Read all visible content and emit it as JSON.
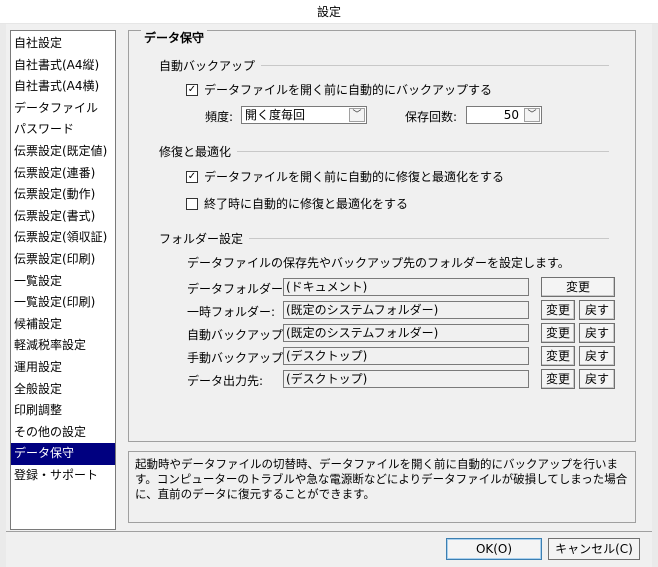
{
  "window": {
    "title": "設定"
  },
  "sidebar": {
    "items": [
      "自社設定",
      "自社書式(A4縦)",
      "自社書式(A4横)",
      "データファイル",
      "パスワード",
      "伝票設定(既定値)",
      "伝票設定(連番)",
      "伝票設定(動作)",
      "伝票設定(書式)",
      "伝票設定(領収証)",
      "伝票設定(印刷)",
      "一覧設定",
      "一覧設定(印刷)",
      "候補設定",
      "軽減税率設定",
      "運用設定",
      "全般設定",
      "印刷調整",
      "その他の設定",
      "データ保守",
      "登録・サポート"
    ],
    "selected_index": 19
  },
  "main": {
    "title": "データ保守",
    "auto_backup": {
      "section_label": "自動バックアップ",
      "checkbox_label": "データファイルを開く前に自動的にバックアップする",
      "checked": true,
      "frequency_label": "頻度:",
      "frequency_value": "開く度毎回",
      "count_label": "保存回数:",
      "count_value": "50"
    },
    "repair": {
      "section_label": "修復と最適化",
      "open_label": "データファイルを開く前に自動的に修復と最適化をする",
      "open_checked": true,
      "exit_label": "終了時に自動的に修復と最適化をする",
      "exit_checked": false
    },
    "folders": {
      "section_label": "フォルダー設定",
      "description": "データファイルの保存先やバックアップ先のフォルダーを設定します。",
      "rows": [
        {
          "label": "データフォルダー:",
          "value": "(ドキュメント)"
        },
        {
          "label": "一時フォルダー:",
          "value": "(既定のシステムフォルダー)"
        },
        {
          "label": "自動バックアップ:",
          "value": "(既定のシステムフォルダー)"
        },
        {
          "label": "手動バックアップ:",
          "value": "(デスクトップ)"
        },
        {
          "label": "データ出力先:",
          "value": "(デスクトップ)"
        }
      ],
      "change_label": "変更",
      "reset_label": "戻す"
    }
  },
  "description": {
    "text": "起動時やデータファイルの切替時、データファイルを開く前に自動的にバックアップを行います。コンピューターのトラブルや急な電源断などによりデータファイルが破損してしまった場合に、直前のデータに復元することができます。"
  },
  "footer": {
    "ok_label": "OK(O)",
    "cancel_label": "キャンセル(C)"
  },
  "colors": {
    "selected_bg": "#000080",
    "selected_fg": "#ffffff"
  }
}
